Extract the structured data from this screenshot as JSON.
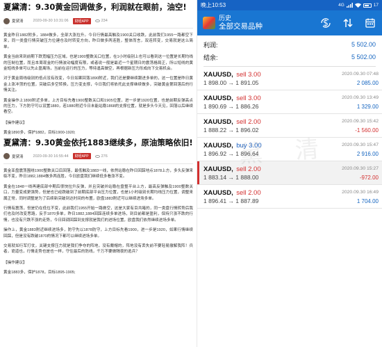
{
  "article1": {
    "title": "夏黛清：9.30黄金回调做多，利润就在眼前，油空!",
    "author": "夏黛清",
    "date": "2020-09-30 10:31:06",
    "app_button": "财经APP",
    "views": "234",
    "paragraphs": [
      "黄金昨日1882附多，1884做多，全部大涨拉升。今日行情最高触及1900关口收跌，此前我们1955一路都空下来，同一类盘行情突破压力位建仓及时转变方向，昨日做多两连胜，整体而言，双连转变，交易就是这么简单。",
      "黄金当前来到前期下跌宽幅压力区域，也是1900整数关口位置，在1小时级别上也可以看到这一位置是长期均线的压制位置，而且本周现金的行情波动幅度有限，或者说一般是最近一个星期日的震荡格局正，所以短线的黄金短线多单可以先止盈离场，当前在运行的压力，等待逢高做空，再根据新压力形成向下交易机会。",
      "对于黄金周线级别的低点没有改变，今日如果回落1890附近，我们还是要继续跟进多单的，这一位置是昨日黄金上涨冲顶的位置，突破后多空转换，压力变支撑，今日我们将依托此支撑继续做多，突破黄金第回落后的行情关注。",
      "黄金操作上1890附近多单，上方目标先看1900整数关口和1905位置，进一步是1920位置，也是前期反弹高点的压力，下方防守可以设置1880，若1880附近今日未能站稳1868的支撑位置，就是多头今天见，回落以后继续看空。"
    ],
    "ops_label": "【操作建议】",
    "ops_text": "黄金1890多，保护1882，目标1900-1920;"
  },
  "article2": {
    "title": "夏黛清：9.30黄金依托1883继续多，原油策略依旧!",
    "author": "夏黛清",
    "date": "2020-09-30 16:55:44",
    "app_button": "财经APP",
    "views": "276",
    "paragraphs": [
      "黄金亚盘震荡围绕1900整数关口后回落，最低触及1883一线，依然站稳在昨日回踩地点1878上方，多头反弹来临不变，昨日1882,1884做多两连胜，今日欧盘我们继续低多看涨不变。",
      "黄金在1848一线再建底部中期后很快拉升反弹，并且突破并站稳在盘整平台上方，最高反弹触及1900整数关口，力量变成更强势，但是也已经跌破到了前期底部平台压力位置，也是1小时级别长期均线压力位置，调整来属正常，同时调整是为了后续新突破到达时间的布置，欧盘1883附近可以继续进场多单。",
      "行情有震荡，但是仍在低位不变，此前我们1955开始一路做空，这是大家有目共睹的，同一类盘行情转势后我们也及时改变思路，反手1870多单，昨日1882,1884回踩连续多单进场，到目前都是盈利，保持只涨不跌的行情，也没有只跌不涨的走势，今日回调回踩到支撑就是我们的进场位置，欧盘我们依然继续进场多单。",
      "操作上，黄金1883附近继续进场多，防守先以1878防守，上方目标先看1900，进一步是1920，如果行情继续回踩，但是没有跌破1870的情况下都可以继续进场多单。",
      "交易就如行军打仗，关键支撑压力就是我们争夺的阵地，没有戴帽的，阵地没有丢失前不要轻易撤解我阵！兵者，诡道也，行情走势也是也一样，守住最后的防线，千万不要做隔夜的逃兵？"
    ],
    "ops_label": "【操作建议】",
    "ops_text": "黄金1883多，保护1878，目标1895-1905;"
  },
  "status_bar": {
    "time": "晚上10:53",
    "network": "4G",
    "battery": "17"
  },
  "app": {
    "title": "历史",
    "subtitle": "全部交易品种",
    "tools": [
      "dollar-cycle-icon",
      "sort-icon",
      "calendar-icon"
    ]
  },
  "totals": {
    "profit_label": "利润:",
    "profit_value": "5 502.00",
    "balance_label": "结余:",
    "balance_value": "5 502.00"
  },
  "trades": [
    {
      "symbol": "XAUUSD,",
      "side": "sell 3.00",
      "side_type": "sell",
      "time": "2020.09.30 07:48",
      "prices": "1 898.00 → 1 891.05",
      "profit": "2 085.00",
      "profit_type": "pos",
      "highlight": false
    },
    {
      "symbol": "XAUUSD,",
      "side": "sell 3.00",
      "side_type": "sell",
      "time": "2020.09.30 13:49",
      "prices": "1 890.69 → 1 886.26",
      "profit": "1 329.00",
      "profit_type": "pos",
      "highlight": false
    },
    {
      "symbol": "XAUUSD,",
      "side": "sell 2.00",
      "side_type": "sell",
      "time": "2020.09.30 15:42",
      "prices": "1 888.22 → 1 896.02",
      "profit": "-1 560.00",
      "profit_type": "neg",
      "highlight": false
    },
    {
      "symbol": "XAUUSD,",
      "side": "buy 3.00",
      "side_type": "buy",
      "time": "2020.09.30 15:47",
      "prices": "1 896.92 → 1 896.64",
      "profit": "2 916.00",
      "profit_type": "pos",
      "highlight": false
    },
    {
      "symbol": "XAUUSD,",
      "side": "sell 2.00",
      "side_type": "sell",
      "time": "2020.09.30 15:27",
      "prices": "1 883.14 → 1 888.00",
      "profit": "-972.00",
      "profit_type": "neg",
      "highlight": true
    },
    {
      "symbol": "XAUUSD,",
      "side": "sell 2.00",
      "side_type": "sell",
      "time": "2020.09.30 16:49",
      "prices": "1 896.41 → 1 887.89",
      "profit": "1 704.00",
      "profit_type": "pos",
      "highlight": false
    }
  ],
  "colors": {
    "appbar": "#1976d2",
    "statusbar": "#1663c4",
    "sell": "#d32f2f",
    "buy": "#1e63c4",
    "profit_positive": "#1565c0",
    "profit_negative": "#d32f2f"
  }
}
